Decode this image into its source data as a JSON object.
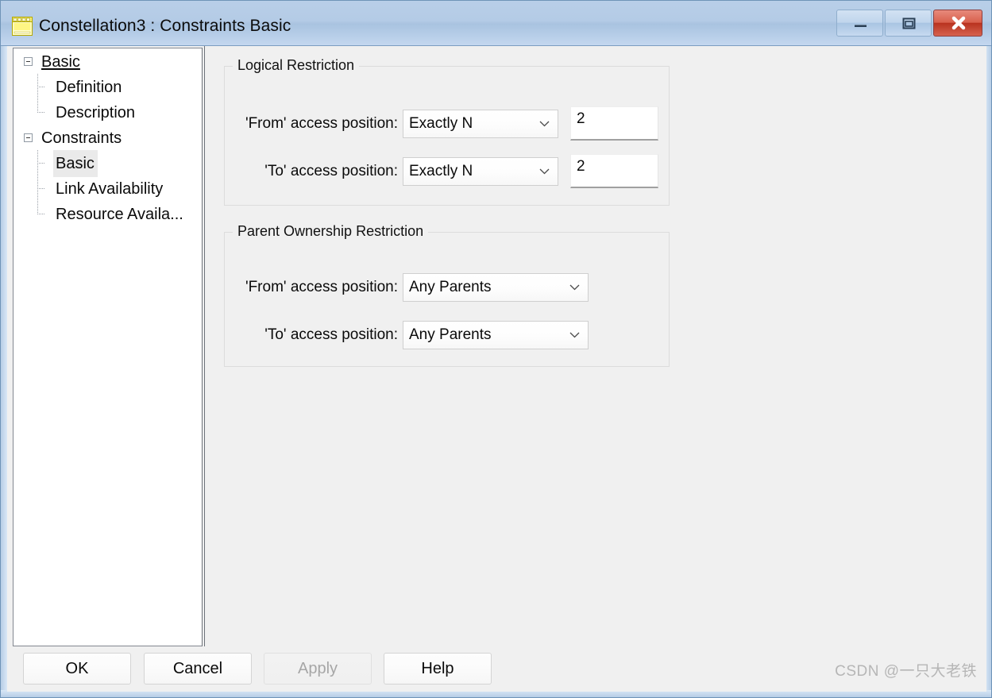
{
  "window": {
    "title": "Constellation3 : Constraints Basic",
    "icon": "dialog-window-icon",
    "controls": {
      "minimize": "minimize-icon",
      "maximize": "maximize-icon",
      "close": "close-icon"
    }
  },
  "sidebar": {
    "nodes": [
      {
        "label": "Basic",
        "level": "root",
        "expanded": true,
        "selected": false,
        "link": true
      },
      {
        "label": "Definition",
        "level": "child",
        "expanded": false,
        "selected": false,
        "link": false
      },
      {
        "label": "Description",
        "level": "child",
        "expanded": false,
        "selected": false,
        "link": false
      },
      {
        "label": "Constraints",
        "level": "root",
        "expanded": true,
        "selected": false,
        "link": false
      },
      {
        "label": "Basic",
        "level": "child",
        "expanded": false,
        "selected": true,
        "link": false
      },
      {
        "label": "Link Availability",
        "level": "child",
        "expanded": false,
        "selected": false,
        "link": false
      },
      {
        "label": "Resource Availa...",
        "level": "child",
        "expanded": false,
        "selected": false,
        "link": false
      }
    ]
  },
  "content": {
    "groups": [
      {
        "title": "Logical Restriction",
        "rows": [
          {
            "label": "'From' access position:",
            "combo": "Exactly N",
            "value": "2"
          },
          {
            "label": "'To' access position:",
            "combo": "Exactly N",
            "value": "2"
          }
        ]
      },
      {
        "title": "Parent Ownership Restriction",
        "rows": [
          {
            "label": "'From' access position:",
            "combo": "Any Parents"
          },
          {
            "label": "'To' access position:",
            "combo": "Any Parents"
          }
        ]
      }
    ]
  },
  "buttons": {
    "ok": "OK",
    "cancel": "Cancel",
    "apply": "Apply",
    "help": "Help"
  },
  "watermark": "CSDN @一只大老铁",
  "colors": {
    "titlebar_top": "#b9cfe8",
    "titlebar_bottom": "#c3d7ef",
    "close_button": "#b8321f",
    "panel_bg": "#f0f0f0",
    "tree_bg": "#ffffff",
    "selection": "#eaeaea",
    "group_border": "#dcdcdc"
  }
}
